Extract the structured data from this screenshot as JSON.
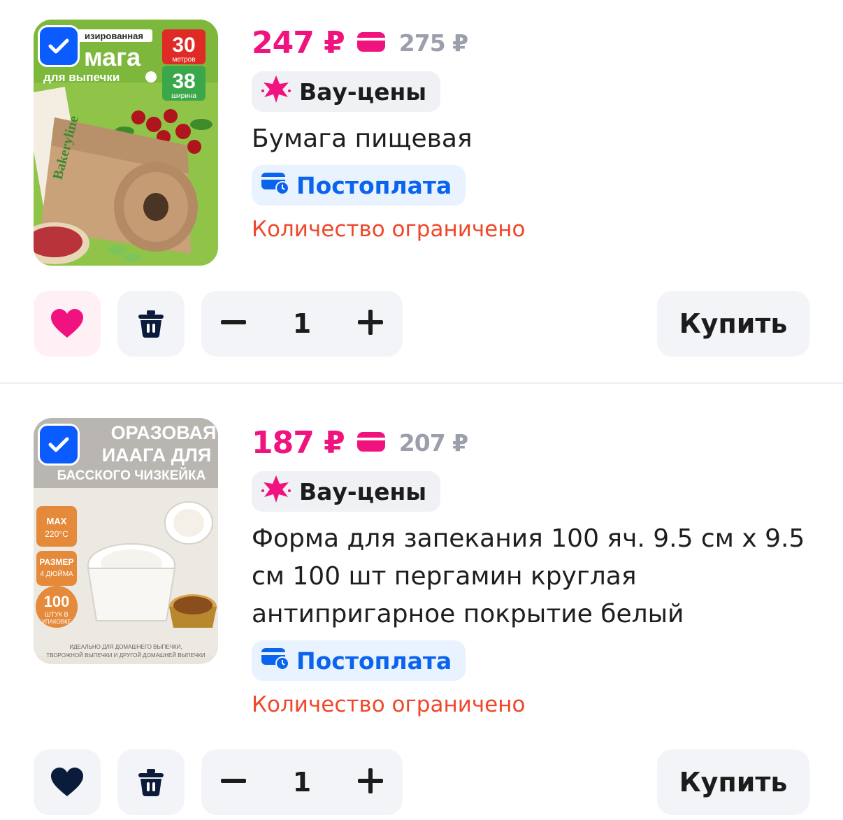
{
  "items": [
    {
      "price": "247 ₽",
      "old_price": "275 ₽",
      "promo_label": "Вау-цены",
      "title": "Бумага пищевая",
      "payment_label": "Постоплата",
      "stock_note": "Количество ограничено",
      "quantity": "1",
      "buy_label": "Купить",
      "selected": true,
      "favorite": true,
      "image_text": {
        "line1": "изированная",
        "line2": "мага",
        "line3": "для выпечки",
        "badge1_num": "30",
        "badge1_unit": "метров",
        "badge2_num": "38",
        "badge2_unit": "ширина",
        "brand": "Bakeryline"
      }
    },
    {
      "price": "187 ₽",
      "old_price": "207 ₽",
      "promo_label": "Вау-цены",
      "title": "Форма для запекания 100 яч. 9.5 см х 9.5 см 100 шт пергамин круглая антипригарное покрытие белый",
      "payment_label": "Постоплата",
      "stock_note": "Количество ограничено",
      "quantity": "1",
      "buy_label": "Купить",
      "selected": true,
      "favorite": false,
      "image_text": {
        "line1": "ОРАЗОВАЯ",
        "line2": "ИААГА ДЛЯ",
        "line3": "БАССКОГО ЧИЗКЕЙКА",
        "max_label": "MAX",
        "max_temp": "220°C",
        "size_label": "РАЗМЕР",
        "size_value": "4 ДЮЙМА",
        "count_num": "100",
        "count_label1": "ШТУК В",
        "count_label2": "УПАКОВКЕ",
        "footer1": "ИДЕАЛЬНО ДЛЯ ДОМАШНЕГО ВЫПЕЧКИ,",
        "footer2": "ТВОРОЖНОЙ ВЫПЕЧКИ И ДРУГОЙ ДОМАШНЕЙ ВЫПЕЧКИ"
      }
    }
  ],
  "colors": {
    "price": "#f0127e",
    "old_price": "#9a9fab",
    "checkbox": "#0a5cff",
    "postpay": "#0b64ed",
    "limited": "#f0472a",
    "heart_active": "#f0127e",
    "heart_inactive": "#0b1b3a"
  },
  "icons": [
    "checkbox-checked-icon",
    "wallet-card-icon",
    "wow-star-icon",
    "postpay-card-clock-icon",
    "heart-icon",
    "trash-icon",
    "minus-icon",
    "plus-icon"
  ]
}
